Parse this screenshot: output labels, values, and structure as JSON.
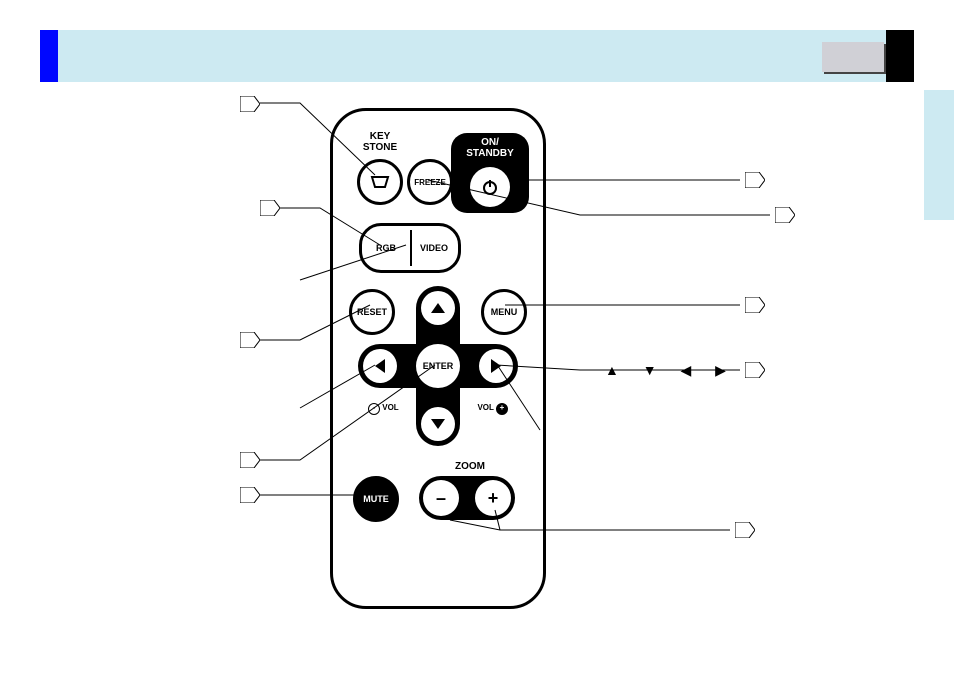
{
  "header": {},
  "remote": {
    "keystone_line1": "KEY",
    "keystone_line2": "STONE",
    "freeze": "FREEZE",
    "onstandby_line1": "ON/",
    "onstandby_line2": "STANDBY",
    "rgb": "RGB",
    "video": "VIDEO",
    "reset": "RESET",
    "menu": "MENU",
    "enter": "ENTER",
    "vol_minus_label": "VOL",
    "vol_plus_label": "VOL",
    "zoom": "ZOOM",
    "mute": "MUTE",
    "zoom_minus": "–",
    "zoom_plus": "+"
  },
  "glyphs": "▲ ▼ ◀ ▶"
}
